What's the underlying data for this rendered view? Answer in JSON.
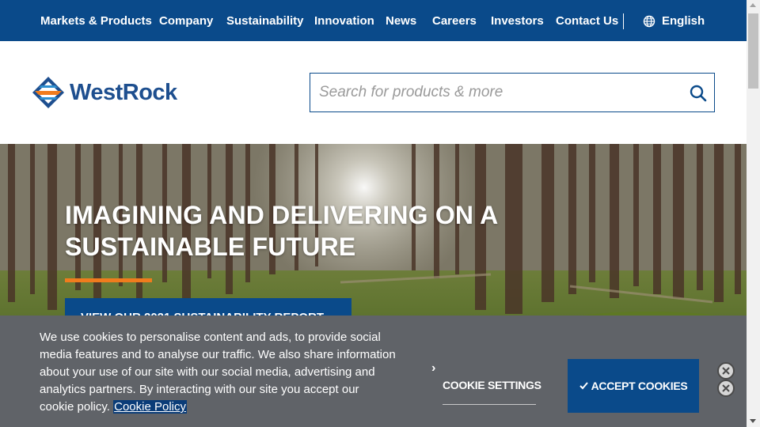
{
  "topnav": {
    "items": [
      {
        "label": "Markets & Products"
      },
      {
        "label": "Company"
      },
      {
        "label": "Sustainability"
      },
      {
        "label": "Innovation"
      },
      {
        "label": "News"
      },
      {
        "label": "Careers"
      },
      {
        "label": "Investors"
      },
      {
        "label": "Contact Us"
      }
    ],
    "language": "English",
    "language_icon": "globe-icon"
  },
  "header": {
    "logo_text": "WestRock",
    "search": {
      "placeholder": "Search for products & more",
      "value": "",
      "icon": "search-icon"
    }
  },
  "hero": {
    "title": "IMAGINING AND DELIVERING ON A SUSTAINABLE FUTURE",
    "cta_label": "VIEW OUR 2021 SUSTAINABILITY REPORT"
  },
  "cookie_banner": {
    "text": "We use cookies to personalise content and ads, to provide social media features and to analyse our traffic. We also share information about your use of our site with our social media, advertising and analytics partners. By interacting with our site you accept our cookie policy.",
    "link_label": "Cookie Policy",
    "settings_label": "COOKIE SETTINGS",
    "accept_label": "ACCEPT COOKIES"
  },
  "colors": {
    "brand_blue": "#0a4a8a",
    "accent_orange": "#f07c1d",
    "banner_gray": "#606368"
  }
}
